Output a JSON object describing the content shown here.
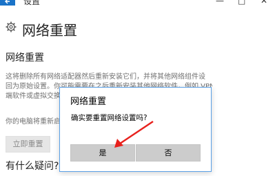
{
  "window": {
    "title": "设置",
    "min_glyph": "—",
    "max_glyph": "□",
    "close_glyph": "✕"
  },
  "page": {
    "title": "网络重置",
    "section_title": "网络重置",
    "description_lines": [
      "这将删除所有网络适配器然后重新安装它们，并将其他网络组件设",
      "回为原始设置。你可能需要在之后重新安装其他网络软件，例如 VPN 客户",
      "端软件或虚拟交换机。"
    ],
    "restart_note": "你的电脑将重新启动。",
    "reset_button": "立即重置",
    "question_heading": "有什么疑问?"
  },
  "dialog": {
    "title": "网络重置",
    "message": "确实要重置网络设置吗?",
    "yes_button": "是",
    "no_button": "否"
  },
  "colors": {
    "accent": "#1a73c8",
    "annotation_arrow": "#e8211d"
  }
}
